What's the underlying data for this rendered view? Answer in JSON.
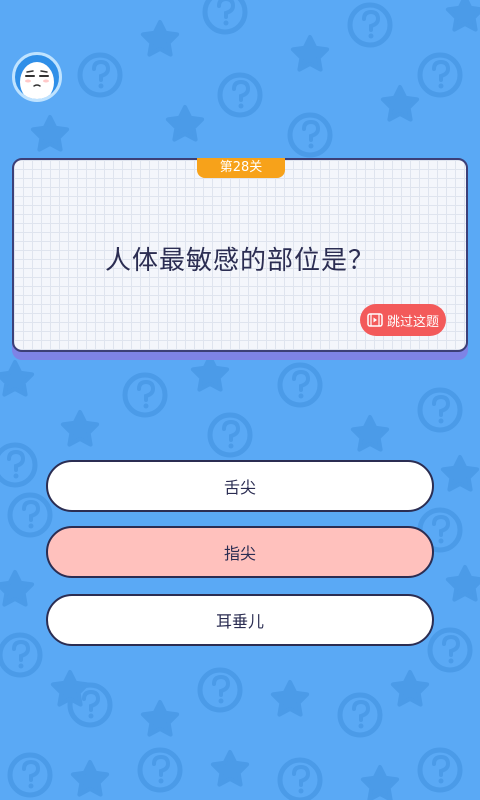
{
  "level": {
    "label": "第28关"
  },
  "question": {
    "text": "人体最敏感的部位是？"
  },
  "skip": {
    "label": "跳过这题",
    "icon": "video-icon"
  },
  "options": [
    {
      "label": "舌尖",
      "selected": false
    },
    {
      "label": "指尖",
      "selected": true
    },
    {
      "label": "耳垂儿",
      "selected": false
    }
  ],
  "colors": {
    "background": "#5aa9f5",
    "badge": "#f7a21a",
    "skip": "#f35a5a",
    "selected_option": "#ffc1bd",
    "outline": "#2b2d52"
  }
}
